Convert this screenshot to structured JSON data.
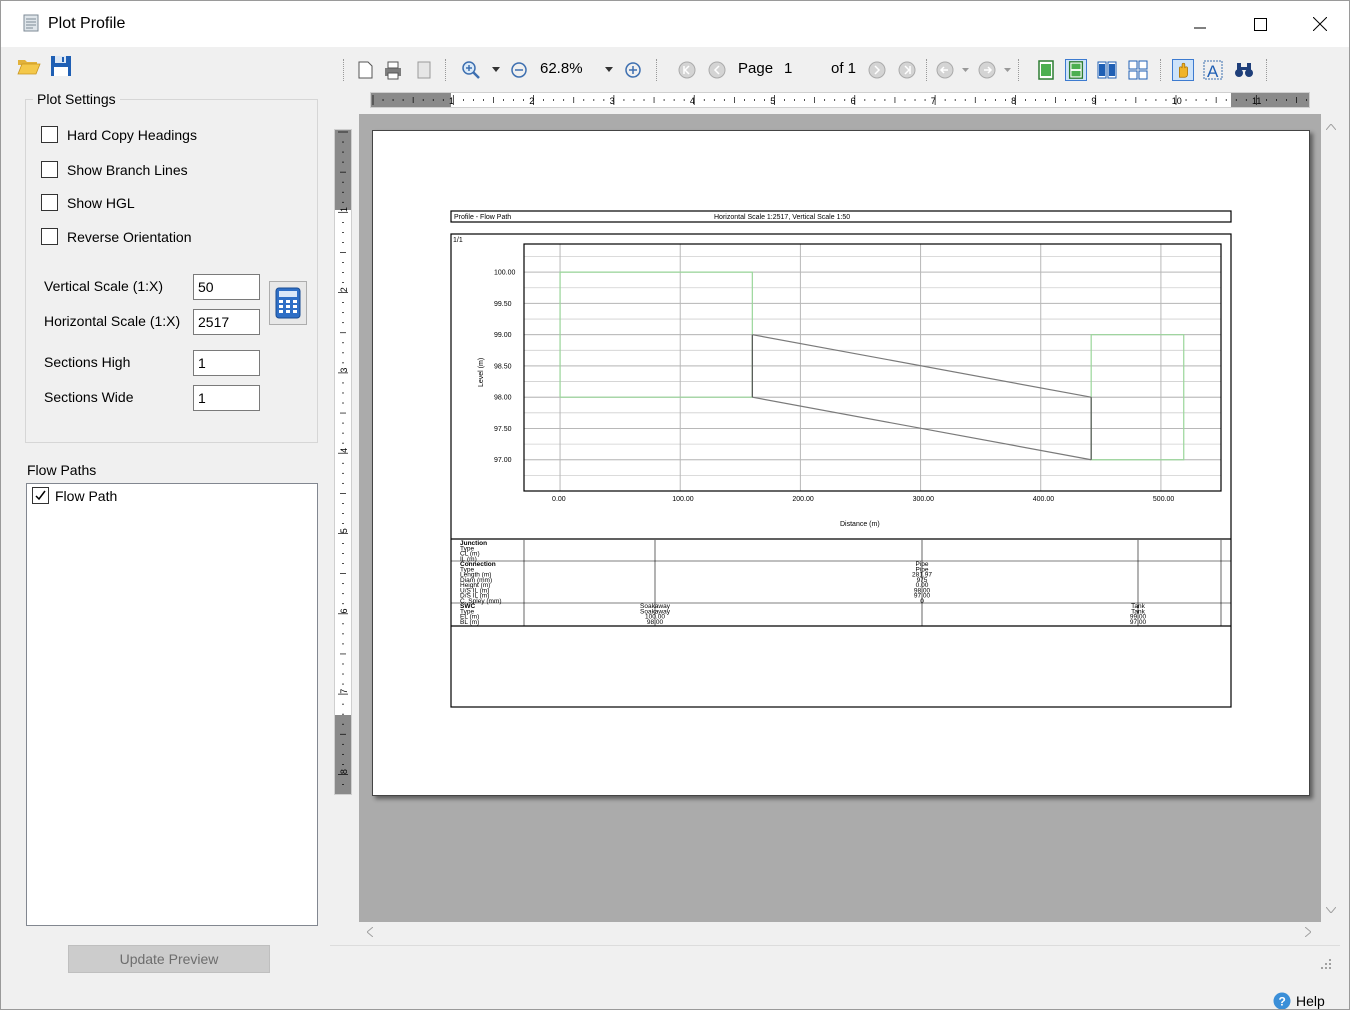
{
  "window": {
    "title": "Plot Profile"
  },
  "plot_settings": {
    "group_title": "Plot Settings",
    "checkboxes": [
      {
        "label": "Hard Copy Headings",
        "checked": false
      },
      {
        "label": "Show Branch Lines",
        "checked": false
      },
      {
        "label": "Show HGL",
        "checked": false
      },
      {
        "label": "Reverse Orientation",
        "checked": false
      }
    ],
    "fields": [
      {
        "label": "Vertical Scale (1:X)",
        "value": "50"
      },
      {
        "label": "Horizontal Scale (1:X)",
        "value": "2517"
      },
      {
        "label": "Sections High",
        "value": "1"
      },
      {
        "label": "Sections Wide",
        "value": "1"
      }
    ]
  },
  "flow_paths": {
    "label": "Flow Paths",
    "items": [
      {
        "label": "Flow Path",
        "checked": true
      }
    ]
  },
  "update_button": "Update Preview",
  "preview_toolbar": {
    "zoom": "62.8%",
    "page_label": "Page",
    "page_value": "1",
    "of_label": "of 1"
  },
  "ruler_h_labels": [
    "1",
    "2",
    "3",
    "4",
    "5",
    "6",
    "7",
    "8",
    "9",
    "10",
    "11"
  ],
  "ruler_v_labels": [
    "1",
    "2",
    "3",
    "4",
    "5",
    "6",
    "7",
    "8"
  ],
  "help_label": "Help",
  "page": {
    "header_left": "Profile - Flow Path",
    "header_center": "Horizontal Scale 1:2517, Vertical Scale 1:50",
    "sheet_label": "1/1"
  },
  "chart_data": {
    "type": "line",
    "title": "",
    "xlabel": "Distance (m)",
    "ylabel": "Level (m)",
    "xlim": [
      -30,
      550
    ],
    "ylim": [
      96.5,
      100.45
    ],
    "x_ticks": [
      "0.00",
      "100.00",
      "200.00",
      "300.00",
      "400.00",
      "500.00"
    ],
    "x_tick_values": [
      0,
      100,
      200,
      300,
      400,
      500
    ],
    "y_ticks": [
      "100.00",
      "99.50",
      "99.00",
      "98.50",
      "98.00",
      "97.50",
      "97.00"
    ],
    "y_tick_values": [
      100.0,
      99.5,
      99.0,
      98.5,
      98.0,
      97.5,
      97.0
    ],
    "grid": true,
    "series": [
      {
        "color": "#9ad69a",
        "points": [
          [
            0,
            98.0
          ],
          [
            0,
            100.0
          ],
          [
            160,
            100.0
          ],
          [
            160,
            98.0
          ],
          [
            0,
            98.0
          ]
        ]
      },
      {
        "color": "#9ad69a",
        "points": [
          [
            441.97,
            97.0
          ],
          [
            441.97,
            99.0
          ],
          [
            519,
            99.0
          ],
          [
            519,
            97.0
          ],
          [
            441.97,
            97.0
          ]
        ]
      },
      {
        "color": "#7a7a7a",
        "points": [
          [
            160,
            99.0
          ],
          [
            441.97,
            98.0
          ]
        ]
      },
      {
        "color": "#7a7a7a",
        "points": [
          [
            160,
            98.0
          ],
          [
            441.97,
            97.0
          ]
        ]
      },
      {
        "color": "#555555",
        "points": [
          [
            160,
            98.0
          ],
          [
            160,
            99.0
          ]
        ]
      },
      {
        "color": "#555555",
        "points": [
          [
            441.97,
            97.0
          ],
          [
            441.97,
            98.0
          ]
        ]
      }
    ]
  },
  "profile_table": {
    "sections": [
      {
        "title": "Junction",
        "rows": [
          "Type",
          "CL (m)",
          "IL (m)"
        ]
      },
      {
        "title": "Connection",
        "rows": [
          "Type",
          "Length (m)",
          "Diam (mm)",
          "Height (m)",
          "U/S IL (m)",
          "D/S IL (m)",
          "C. Spley (mm)"
        ]
      },
      {
        "title": "SWC",
        "rows": [
          "Type",
          "EL (m)",
          "BL (m)"
        ]
      }
    ],
    "connection_values": [
      "Pipe",
      "Pipe",
      "281.97",
      "975",
      "0.00",
      "98.00",
      "97.00",
      "0"
    ],
    "swc_left_values": [
      "Soakaway",
      "Soakaway",
      "100.00",
      "98.00"
    ],
    "swc_right_values": [
      "Tank",
      "Tank",
      "99.00",
      "97.00"
    ]
  }
}
